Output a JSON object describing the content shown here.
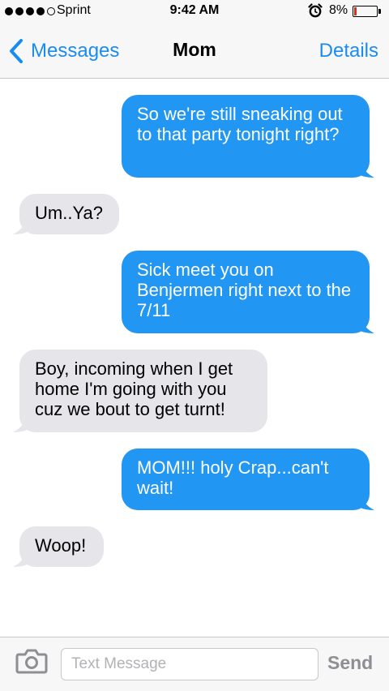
{
  "status_bar": {
    "carrier": "Sprint",
    "time": "9:42 AM",
    "battery_percent": "8%",
    "battery_level": 0.08,
    "signal_bars_filled": 4,
    "signal_bars_total": 5,
    "icons": [
      "signal-dots-icon",
      "alarm-clock-icon",
      "battery-icon"
    ],
    "battery_color": "#e02a1c"
  },
  "nav": {
    "back_label": "Messages",
    "title": "Mom",
    "details_label": "Details",
    "accent_color": "#1a8cf0"
  },
  "messages": [
    {
      "direction": "outgoing",
      "text": "So we're still sneaking out to that party tonight right?"
    },
    {
      "direction": "incoming",
      "text": "Um..Ya?"
    },
    {
      "direction": "outgoing",
      "text": "Sick meet you on Benjermen right next to the 7/11"
    },
    {
      "direction": "incoming",
      "text": "Boy, incoming when I get home I'm going with you cuz we bout to get turnt!"
    },
    {
      "direction": "outgoing",
      "text": "MOM!!! holy Crap...can't wait!"
    },
    {
      "direction": "incoming",
      "text": "Woop!"
    }
  ],
  "colors": {
    "outgoing_bubble": "#2196f3",
    "incoming_bubble": "#e5e5ea"
  },
  "composer": {
    "placeholder": "Text Message",
    "value": "",
    "send_label": "Send",
    "camera_icon": "camera-icon"
  }
}
